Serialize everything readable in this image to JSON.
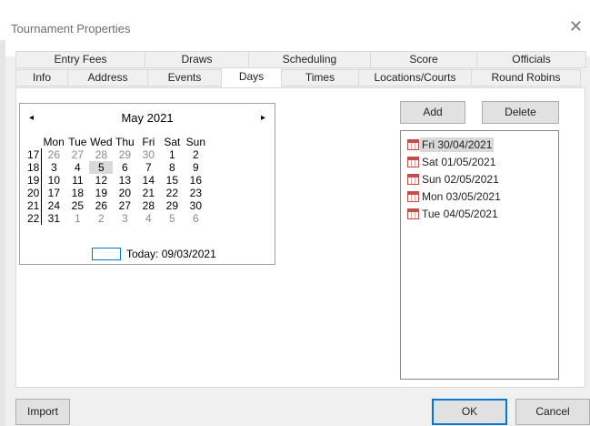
{
  "window": {
    "title": "Tournament Properties",
    "close_glyph": "✕"
  },
  "tabs_row1": [
    "Entry Fees",
    "Draws",
    "Scheduling",
    "Score",
    "Officials"
  ],
  "tabs_row2": [
    "Info",
    "Address",
    "Events",
    "Days",
    "Times",
    "Locations/Courts",
    "Round Robins"
  ],
  "selected_tab": "Days",
  "calendar": {
    "prev_glyph": "◂",
    "next_glyph": "▸",
    "month_label": "May 2021",
    "day_headers": [
      "Mon",
      "Tue",
      "Wed",
      "Thu",
      "Fri",
      "Sat",
      "Sun"
    ],
    "weeks": [
      {
        "week": "17",
        "days": [
          "26",
          "27",
          "28",
          "29",
          "30",
          "1",
          "2"
        ]
      },
      {
        "week": "18",
        "days": [
          "3",
          "4",
          "5",
          "6",
          "7",
          "8",
          "9"
        ]
      },
      {
        "week": "19",
        "days": [
          "10",
          "11",
          "12",
          "13",
          "14",
          "15",
          "16"
        ]
      },
      {
        "week": "20",
        "days": [
          "17",
          "18",
          "19",
          "20",
          "21",
          "22",
          "23"
        ]
      },
      {
        "week": "21",
        "days": [
          "24",
          "25",
          "26",
          "27",
          "28",
          "29",
          "30"
        ]
      },
      {
        "week": "22",
        "days": [
          "31",
          "1",
          "2",
          "3",
          "4",
          "5",
          "6"
        ]
      }
    ],
    "today_label": "Today: 09/03/2021",
    "selected_day": "5"
  },
  "buttons": {
    "add": "Add",
    "delete": "Delete",
    "import": "Import",
    "ok": "OK",
    "cancel": "Cancel"
  },
  "days_list": [
    {
      "label": "Fri 30/04/2021",
      "selected": true
    },
    {
      "label": "Sat 01/05/2021",
      "selected": false
    },
    {
      "label": "Sun 02/05/2021",
      "selected": false
    },
    {
      "label": "Mon 03/05/2021",
      "selected": false
    },
    {
      "label": "Tue 04/05/2021",
      "selected": false
    }
  ],
  "colors": {
    "accent": "#0078d7",
    "icon": "#c0504d",
    "selection": "#d9d9d9"
  },
  "icons": {
    "list_item": "calendar-icon"
  }
}
